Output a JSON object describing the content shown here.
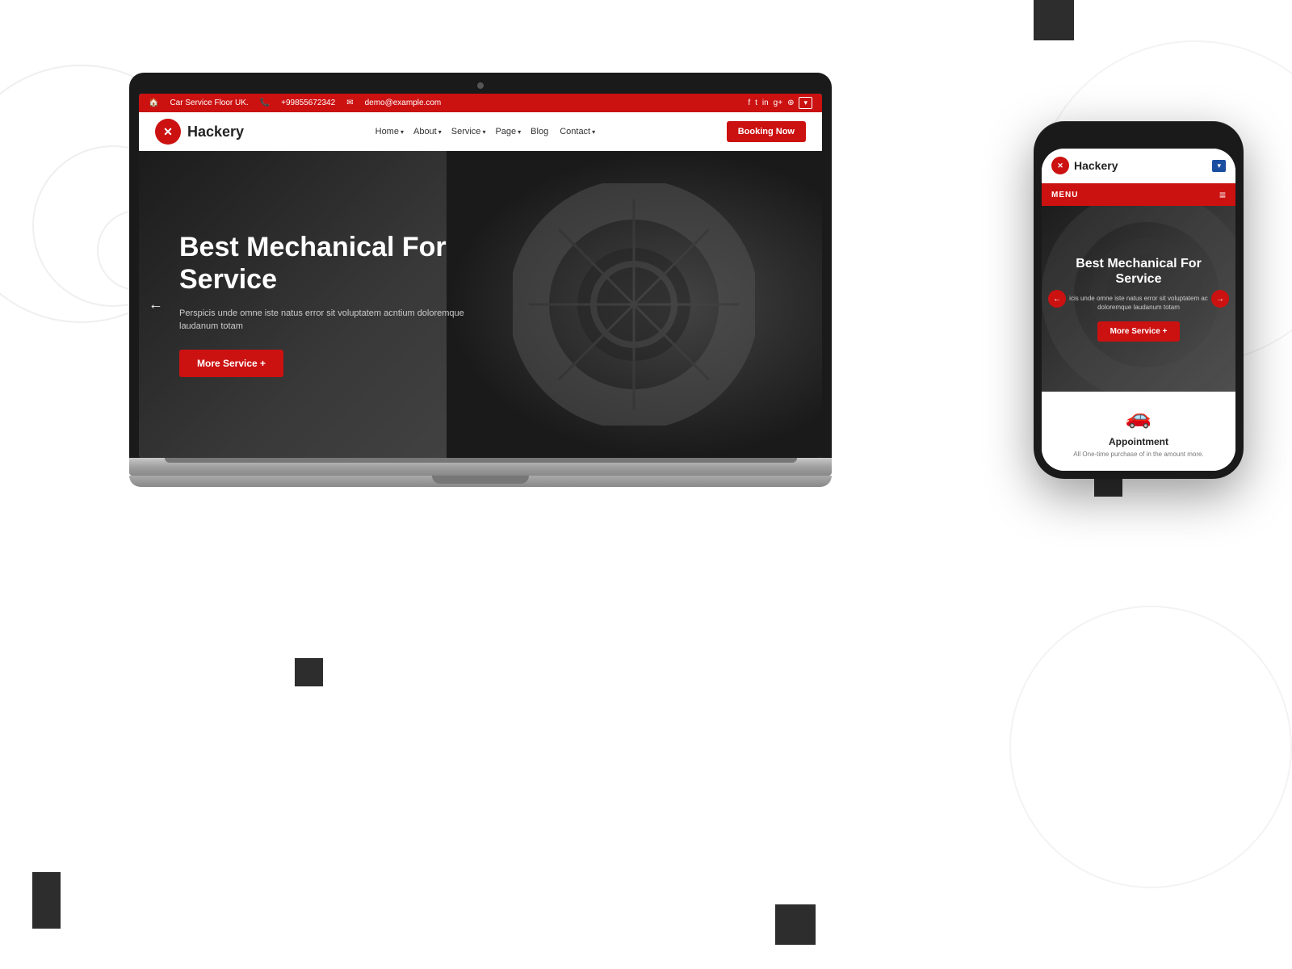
{
  "background": {
    "color": "#ffffff"
  },
  "laptop": {
    "topbar": {
      "address": "Car Service Floor UK.",
      "phone": "+99855672342",
      "email": "demo@example.com",
      "lang_btn": "▾"
    },
    "navbar": {
      "logo_text": "Hackery",
      "nav_items": [
        "Home",
        "About",
        "Service",
        "Page",
        "Blog",
        "Contact"
      ],
      "booking_btn": "Booking Now"
    },
    "hero": {
      "title": "Best Mechanical For Service",
      "description": "Perspicis unde omne iste natus error sit voluptatem acntium doloremque laudanum totam",
      "cta_btn": "More Service +",
      "arrow_left": "←"
    }
  },
  "phone": {
    "header": {
      "logo_text": "Hackery",
      "lang_btn": "▾"
    },
    "menu": {
      "label": "MENU",
      "hamburger": "≡"
    },
    "hero": {
      "title": "Best Mechanical For Service",
      "description": "icis unde omne iste natus error sit voluptatem ac doloremque laudanum totam",
      "cta_btn": "More Service +",
      "arrow_left": "←",
      "arrow_right": "→"
    },
    "service": {
      "icon": "🚗",
      "title": "Appointment",
      "description": "All One-time purchase of in the amount more."
    }
  }
}
